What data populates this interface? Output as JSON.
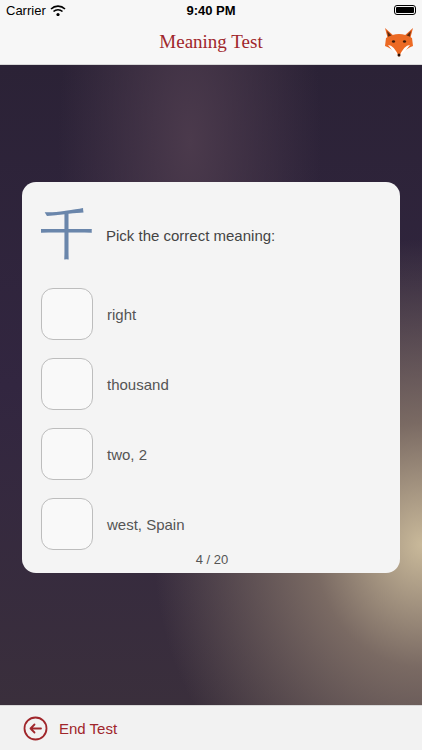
{
  "status_bar": {
    "carrier": "Carrier",
    "time": "9:40 PM"
  },
  "nav": {
    "title": "Meaning Test"
  },
  "question": {
    "kanji": "千",
    "prompt": "Pick the correct meaning:",
    "progress": "4 / 20"
  },
  "options": [
    {
      "label": "right",
      "checked": false
    },
    {
      "label": "thousand",
      "checked": false
    },
    {
      "label": "two, 2",
      "checked": false
    },
    {
      "label": "west, Spain",
      "checked": false
    }
  ],
  "footer": {
    "button": "End Test"
  }
}
